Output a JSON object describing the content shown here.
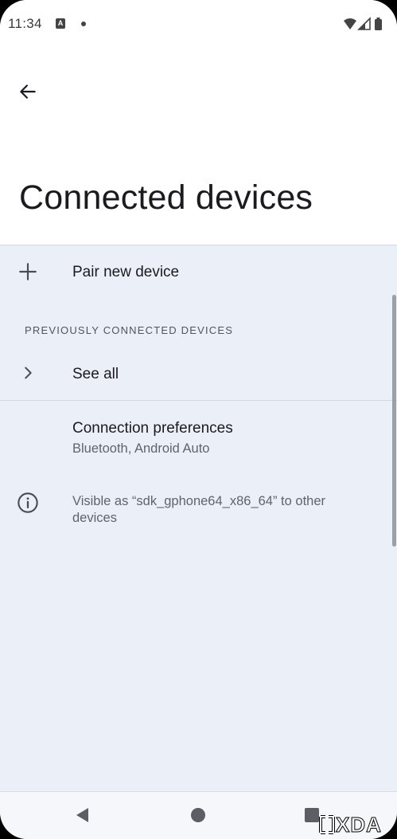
{
  "status_bar": {
    "time": "11:34",
    "notification_icon": "A"
  },
  "header": {
    "title": "Connected devices",
    "back_icon": "arrow-left-icon"
  },
  "pair_new_device": {
    "label": "Pair new device",
    "icon": "plus-icon"
  },
  "previously_connected": {
    "header": "PREVIOUSLY CONNECTED DEVICES",
    "see_all_label": "See all",
    "see_all_icon": "chevron-right-icon"
  },
  "connection_preferences": {
    "title": "Connection preferences",
    "summary": "Bluetooth, Android Auto"
  },
  "device_info": {
    "text": "Visible as “sdk_gphone64_x86_64” to other devices",
    "icon": "info-icon"
  },
  "watermark": {
    "text": "XDA"
  },
  "colors": {
    "background": "#eaeff8",
    "top_background": "#ffffff",
    "text_primary": "#1b1b1f",
    "text_secondary": "#60646c"
  }
}
